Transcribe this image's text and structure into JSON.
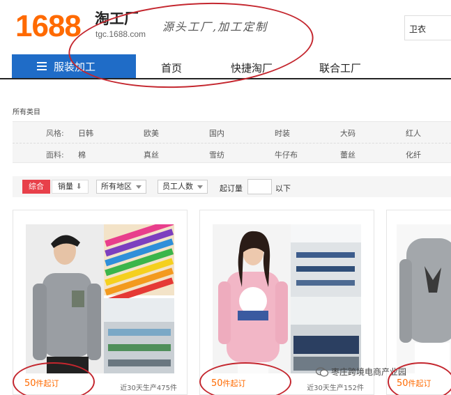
{
  "header": {
    "logo": "1688",
    "brand_title": "淘工厂",
    "brand_domain": "tgc.1688.com",
    "slogan": "源头工厂,加工定制",
    "search_value": "卫衣"
  },
  "nav": {
    "category_label": "服装加工",
    "links": [
      "首页",
      "快捷淘厂",
      "联合工厂"
    ]
  },
  "categories": {
    "all_label": "所有类目",
    "rows": [
      {
        "label": "风格:",
        "items": [
          "日韩",
          "欧美",
          "国内",
          "时装",
          "大码",
          "红人"
        ]
      },
      {
        "label": "面料:",
        "items": [
          "棉",
          "真丝",
          "雪纺",
          "牛仔布",
          "蕾丝",
          "化纤"
        ]
      }
    ]
  },
  "sortbar": {
    "active": "综合",
    "sales": "销量",
    "region": "所有地区",
    "staff": "员工人数",
    "moq_label": "起订量",
    "moq_value": "",
    "moq_unit": "以下"
  },
  "products": [
    {
      "moq_number": "50",
      "moq_unit": "件起订",
      "production": "近30天生产475件"
    },
    {
      "moq_number": "50",
      "moq_unit": "件起订",
      "production": "近30天生产152件"
    },
    {
      "moq_number": "50",
      "moq_unit": "件起订",
      "production": ""
    }
  ],
  "watermark": "枣庄跨境电商产业园",
  "colors": {
    "brand_orange": "#ff6a00",
    "nav_blue": "#1f6cc7",
    "sort_active_red": "#e8404a",
    "annotation_red": "#c4262e"
  }
}
